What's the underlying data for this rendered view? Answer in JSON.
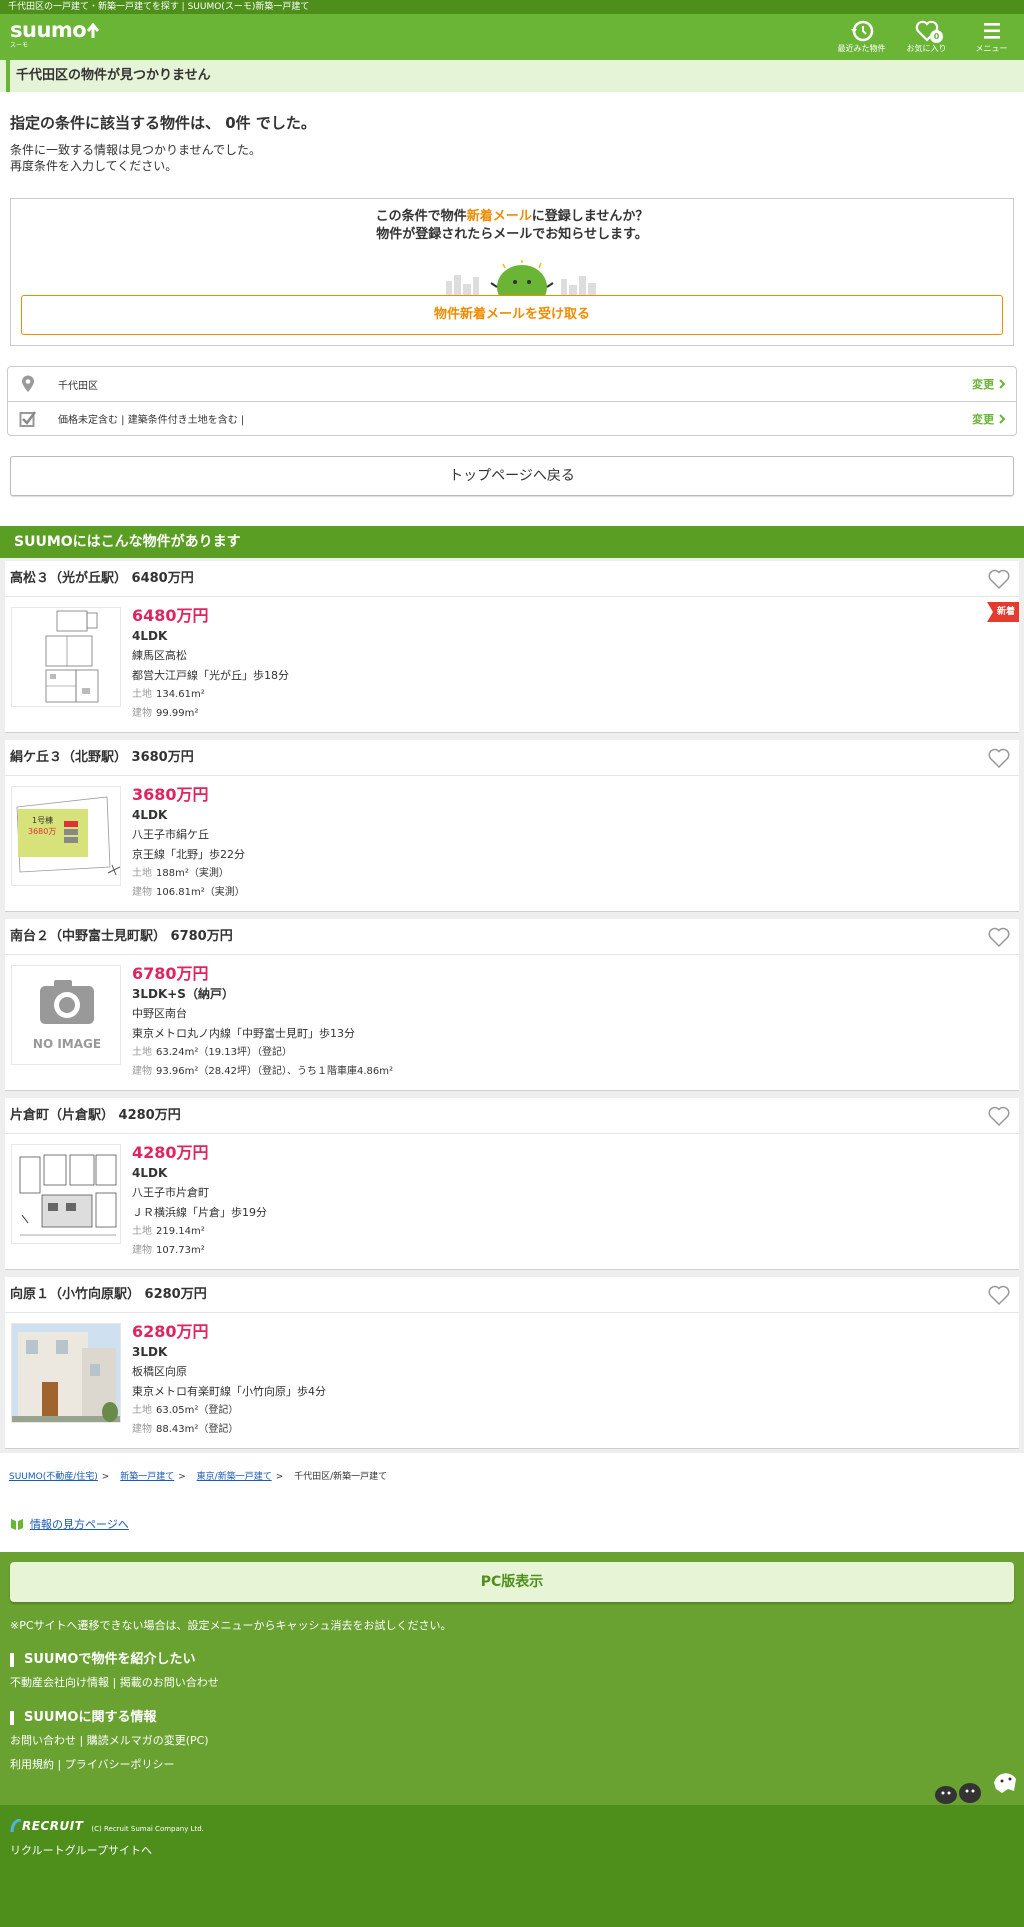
{
  "page_title_bar": "千代田区の一戸建て・新築一戸建てを探す | SUUMO(スーモ)新築一戸建て",
  "header": {
    "logo_text": "suumo",
    "logo_kana": "スーモ",
    "nav": {
      "recent": "最近みた物件",
      "favorites": "お気に入り",
      "favorites_count": "0",
      "menu": "メニュー"
    }
  },
  "notice": "千代田区の物件が見つかりません",
  "result": {
    "heading": "指定の条件に該当する物件は、 0件 でした。",
    "line1": "条件に一致する情報は見つかりませんでした。",
    "line2": "再度条件を入力してください。"
  },
  "mail": {
    "text_pre": "この条件で物件",
    "text_highlight": "新着メール",
    "text_post": "に登録しませんか？",
    "text_line2": "物件が登録されたらメールでお知らせします。",
    "button": "物件新着メールを受け取る"
  },
  "conditions": [
    {
      "icon": "pin-icon",
      "text": "千代田区",
      "change": "変更"
    },
    {
      "icon": "checkbox-icon",
      "text": "価格未定含む | 建築条件付き土地を含む |",
      "change": "変更"
    }
  ],
  "top_button": "トップページへ戻る",
  "suggest_title": "SUUMOにはこんな物件があります",
  "listings": [
    {
      "title": "高松３（光が丘駅） 6480万円",
      "price": "6480万円",
      "madori": "4LDK",
      "address": "練馬区高松",
      "access": "都営大江戸線「光が丘」歩18分",
      "land_label": "土地",
      "land": "134.61m²",
      "bldg_label": "建物",
      "bldg": "99.99m²",
      "new_badge": "新着",
      "thumb": "floorplan"
    },
    {
      "title": "絹ケ丘３（北野駅） 3680万円",
      "price": "3680万円",
      "madori": "4LDK",
      "address": "八王子市絹ケ丘",
      "access": "京王線「北野」歩22分",
      "land_label": "土地",
      "land": "188m²（実測）",
      "bldg_label": "建物",
      "bldg": "106.81m²（実測）",
      "new_badge": "",
      "thumb": "siteplan",
      "thumb_text1": "1号棟",
      "thumb_text2": "3680万"
    },
    {
      "title": "南台２（中野富士見町駅） 6780万円",
      "price": "6780万円",
      "madori": "3LDK+S（納戸）",
      "address": "中野区南台",
      "access": "東京メトロ丸ノ内線「中野富士見町」歩13分",
      "land_label": "土地",
      "land": "63.24m²（19.13坪）（登記）",
      "bldg_label": "建物",
      "bldg": "93.96m²（28.42坪）（登記）、うち１階車庫4.86m²",
      "new_badge": "",
      "thumb": "noimage",
      "thumb_text1": "NO IMAGE"
    },
    {
      "title": "片倉町（片倉駅） 4280万円",
      "price": "4280万円",
      "madori": "4LDK",
      "address": "八王子市片倉町",
      "access": "ＪＲ横浜線「片倉」歩19分",
      "land_label": "土地",
      "land": "219.14m²",
      "bldg_label": "建物",
      "bldg": "107.73m²",
      "new_badge": "",
      "thumb": "floorplan2"
    },
    {
      "title": "向原１（小竹向原駅） 6280万円",
      "price": "6280万円",
      "madori": "3LDK",
      "address": "板橋区向原",
      "access": "東京メトロ有楽町線「小竹向原」歩4分",
      "land_label": "土地",
      "land": "63.05m²（登記）",
      "bldg_label": "建物",
      "bldg": "88.43m²（登記）",
      "new_badge": "",
      "thumb": "photo"
    }
  ],
  "breadcrumb": [
    "SUUMO(不動産/住宅)",
    "新築一戸建て",
    "東京/新築一戸建て",
    "千代田区/新築一戸建て"
  ],
  "howto_link": "情報の見方ページへ",
  "footer": {
    "pc_button": "PC版表示",
    "note": "※PCサイトへ遷移できない場合は、設定メニューからキャッシュ消去をお試しください。",
    "h1": "SUUMOで物件を紹介したい",
    "h1_links": "不動産会社向け情報 | 掲載のお問い合わせ",
    "h2": "SUUMOに関する情報",
    "h2_links1": "お問い合わせ | 購読メルマガの変更(PC)",
    "h2_links2": "利用規約 | プライバシーポリシー",
    "recruit_logo": "RECRUIT",
    "copyright": "(C) Recruit Sumai Company Ltd.",
    "group_link": "リクルートグループサイトへ"
  },
  "colors": {
    "brand_green": "#6ab535",
    "dark_green": "#4e8f1c",
    "price_red": "#e0245e",
    "orange": "#f08c00"
  }
}
